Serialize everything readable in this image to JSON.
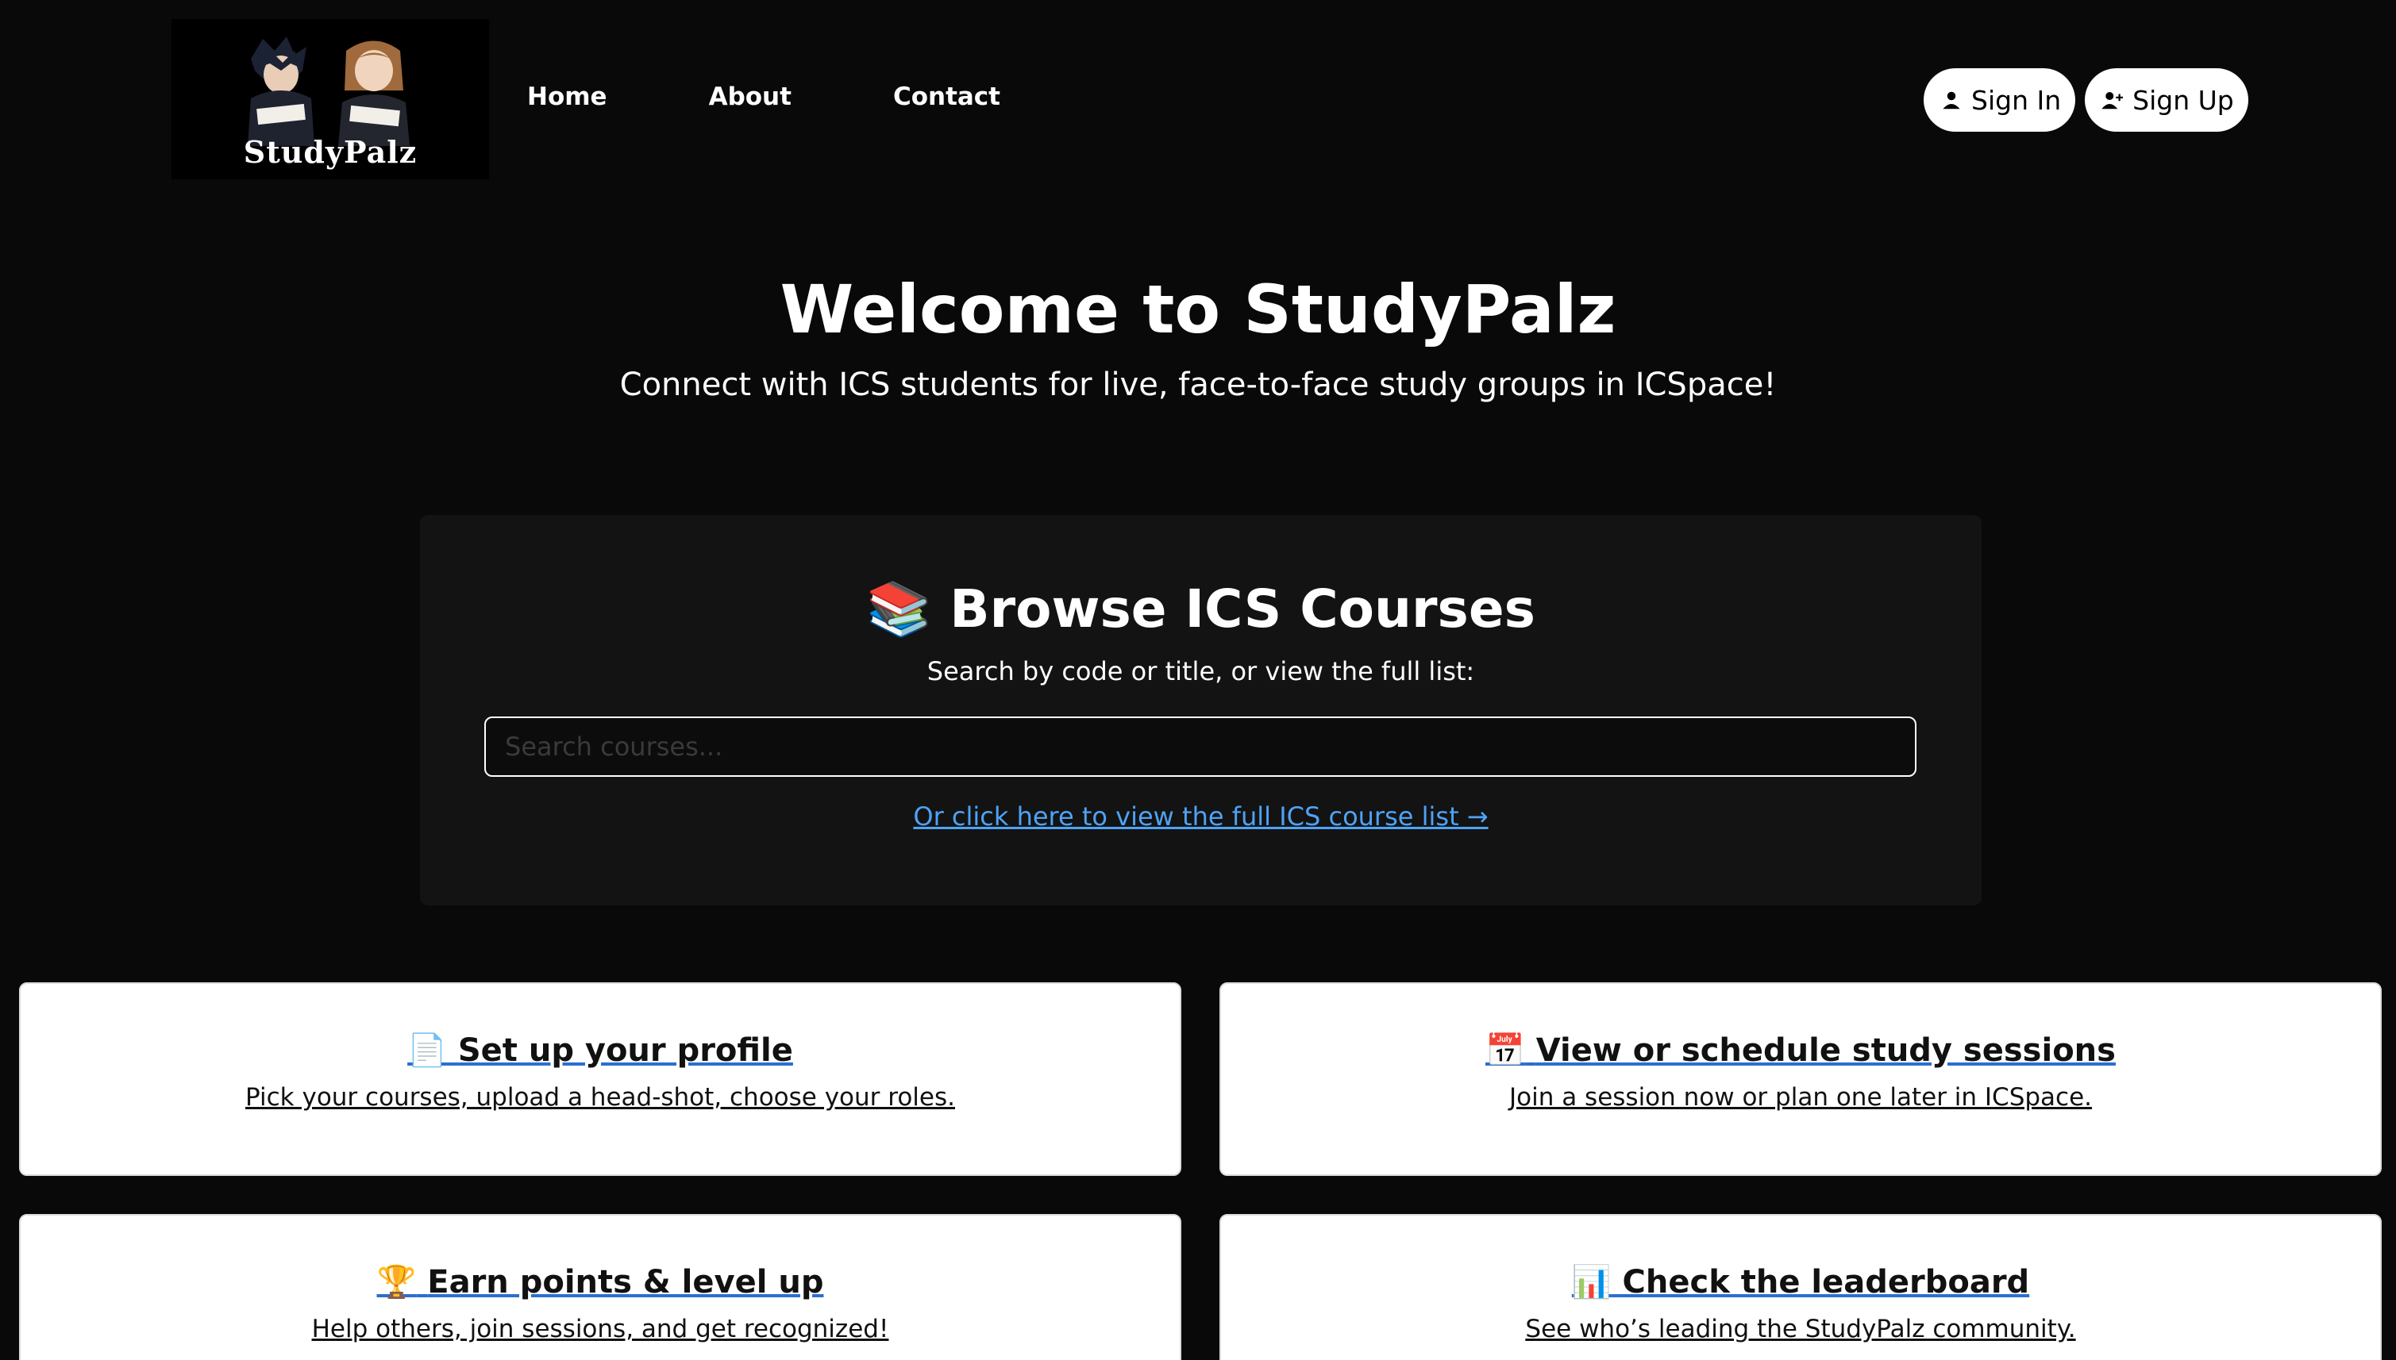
{
  "brand": {
    "name": "StudyPalz"
  },
  "nav": {
    "home": "Home",
    "about": "About",
    "contact": "Contact"
  },
  "auth": {
    "sign_in": "Sign In",
    "sign_up": "Sign Up"
  },
  "hero": {
    "title": "Welcome to StudyPalz",
    "subtitle": "Connect with ICS students for live, face-to-face study groups in ICSpace!"
  },
  "browse": {
    "icon": "books-emoji",
    "title": "Browse ICS Courses",
    "subtitle": "Search by code or title, or view the full list:",
    "search_placeholder": "Search courses...",
    "link": "Or click here to view the full ICS course list →"
  },
  "cards": [
    {
      "icon": "page-emoji",
      "title": "Set up your profile",
      "desc": "Pick your courses, upload a head-shot, choose your roles."
    },
    {
      "icon": "calendar-emoji",
      "title": "View or schedule study sessions",
      "desc": "Join a session now or plan one later in ICSpace."
    },
    {
      "icon": "trophy-emoji",
      "title": "Earn points & level up",
      "desc": "Help others, join sessions, and get recognized!"
    },
    {
      "icon": "bar-chart-emoji",
      "title": "Check the leaderboard",
      "desc": "See who’s leading the StudyPalz community."
    }
  ],
  "colors": {
    "background": "#090909",
    "panel": "#131313",
    "link": "#4ea3f5",
    "card": "#ffffff"
  }
}
